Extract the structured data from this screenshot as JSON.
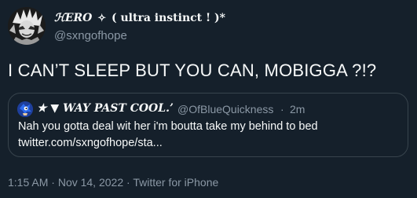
{
  "author": {
    "display_name_prefix": "ℋERO",
    "display_name_sparkle": "✧",
    "display_name_suffix": "( ultra instinct ! )*",
    "handle": "@sxngofhope"
  },
  "tweet": {
    "text": "I CAN’T SLEEP BUT YOU CAN, MOBIGGA ?!?"
  },
  "quoted_tweet": {
    "display_name": "★ ▼ WAY PAST COOL.’",
    "handle": "@OfBlueQuickness",
    "separator": "·",
    "time": "2m",
    "text_line_1": "Nah you gotta deal wit her i'm boutta take my behind to bed",
    "text_line_2": "twitter.com/sxngofhope/sta..."
  },
  "meta": {
    "time": "1:15 AM",
    "separator_1": "·",
    "date": "Nov 14, 2022",
    "separator_2": "·",
    "source": "Twitter for iPhone"
  },
  "colors": {
    "background": "#15202b",
    "primary_text": "#f7f9f9",
    "secondary_text": "#8b98a5",
    "border": "#38444d"
  }
}
